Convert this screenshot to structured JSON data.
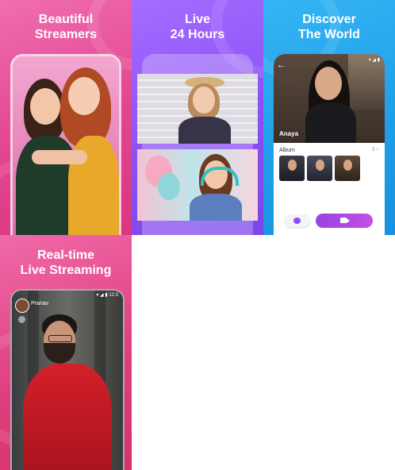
{
  "panels": [
    {
      "headline_line1": "Beautiful",
      "headline_line2": "Streamers"
    },
    {
      "headline_line1": "Live",
      "headline_line2": "24 Hours"
    },
    {
      "headline_line1": "Discover",
      "headline_line2": "The World"
    },
    {
      "headline_line1": "Real-time",
      "headline_line2": "Live Streaming"
    }
  ],
  "discover_screen": {
    "profile_name": "Anaya",
    "album_label": "Album",
    "album_count": "3",
    "album_chevron": "›",
    "back_icon": "arrow-left-icon",
    "chat_icon": "chat-bubble-icon",
    "video_icon": "video-camera-icon"
  },
  "live_screen": {
    "streamer_name": "Pranav",
    "time": "12:3"
  },
  "colors": {
    "pink": "#e2458f",
    "purple": "#8a4ff5",
    "blue": "#1e9ee8",
    "call_button": "#b14ee8"
  }
}
